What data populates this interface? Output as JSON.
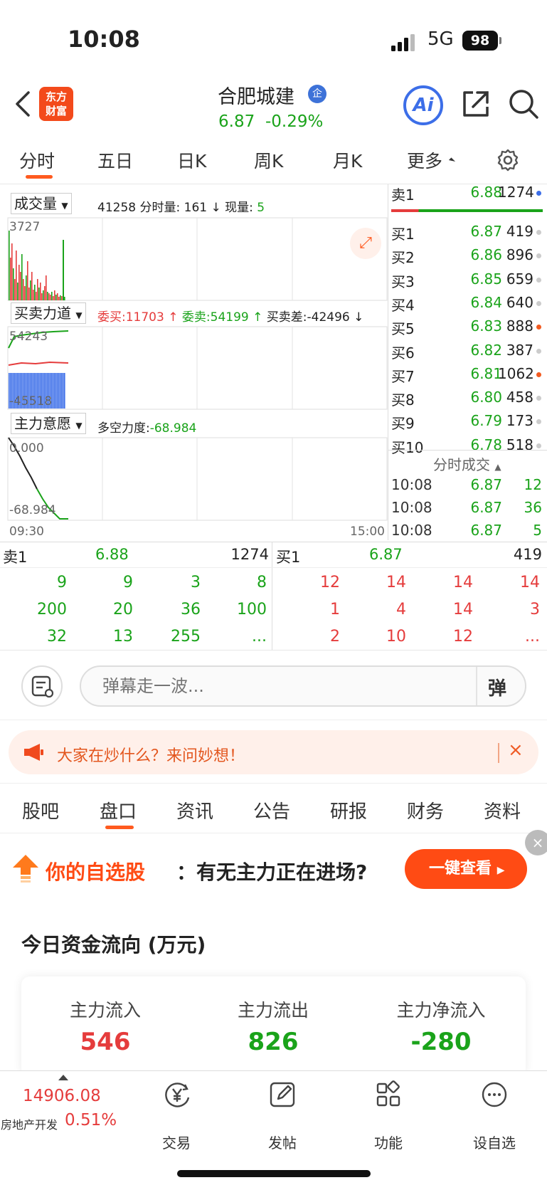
{
  "status": {
    "time": "10:08",
    "network": "5G",
    "battery": "98"
  },
  "header": {
    "logo_top": "东方",
    "logo_bottom": "财富",
    "stock_name": "合肥城建",
    "badge": "企",
    "price": "6.87",
    "change": "-0.29%",
    "ai_label": "Ai",
    "price_color": "#1aa31a"
  },
  "chart_tabs": [
    "分时",
    "五日",
    "日K",
    "周K",
    "月K",
    "更多"
  ],
  "chart": {
    "volume_panel": {
      "label": "成交量",
      "total": "41258",
      "minute_label": "分时量:",
      "minute_value": "161",
      "current_label": "现量:",
      "current_value": "5",
      "max_label": "3727"
    },
    "force_panel": {
      "label": "买卖力道",
      "buy_label": "委买:",
      "buy_value": "11703",
      "sell_label": "委卖:",
      "sell_value": "54199",
      "diff_label": "买卖差:",
      "diff_value": "-42496",
      "top_label": "54243",
      "bottom_label": "-45518"
    },
    "intent_panel": {
      "label": "主力意愿",
      "force_label": "多空力度:",
      "force_value": "-68.984",
      "top_label": "0.000",
      "bottom_label": "-68.984"
    },
    "time_start": "09:30",
    "time_end": "15:00"
  },
  "order_book": {
    "sell": [
      {
        "label": "卖1",
        "price": "6.88",
        "volume": "1274",
        "dot": "#3c6ee8"
      }
    ],
    "buy": [
      {
        "label": "买1",
        "price": "6.87",
        "volume": "419",
        "dot": "#cccccc"
      },
      {
        "label": "买2",
        "price": "6.86",
        "volume": "896",
        "dot": "#cccccc"
      },
      {
        "label": "买3",
        "price": "6.85",
        "volume": "659",
        "dot": "#cccccc"
      },
      {
        "label": "买4",
        "price": "6.84",
        "volume": "640",
        "dot": "#cccccc"
      },
      {
        "label": "买5",
        "price": "6.83",
        "volume": "888",
        "dot": "#f25a1f"
      },
      {
        "label": "买6",
        "price": "6.82",
        "volume": "387",
        "dot": "#cccccc"
      },
      {
        "label": "买7",
        "price": "6.81",
        "volume": "1062",
        "dot": "#f25a1f"
      },
      {
        "label": "买8",
        "price": "6.80",
        "volume": "458",
        "dot": "#cccccc"
      },
      {
        "label": "买9",
        "price": "6.79",
        "volume": "173",
        "dot": "#cccccc"
      },
      {
        "label": "买10",
        "price": "6.78",
        "volume": "518",
        "dot": "#cccccc"
      }
    ],
    "trades_title": "分时成交",
    "trades": [
      {
        "time": "10:08",
        "price": "6.87",
        "volume": "12"
      },
      {
        "time": "10:08",
        "price": "6.87",
        "volume": "36"
      },
      {
        "time": "10:08",
        "price": "6.87",
        "volume": "5"
      }
    ]
  },
  "queue": {
    "sell": {
      "label": "卖1",
      "price": "6.88",
      "volume": "1274",
      "rows": [
        [
          "9",
          "9",
          "3",
          "8"
        ],
        [
          "200",
          "20",
          "36",
          "100"
        ],
        [
          "32",
          "13",
          "255",
          "..."
        ]
      ]
    },
    "buy": {
      "label": "买1",
      "price": "6.87",
      "volume": "419",
      "rows": [
        [
          "12",
          "14",
          "14",
          "14"
        ],
        [
          "1",
          "4",
          "14",
          "3"
        ],
        [
          "2",
          "10",
          "12",
          "..."
        ]
      ]
    }
  },
  "comment": {
    "placeholder": "弹幕走一波...",
    "button": "弹"
  },
  "promo": {
    "text": "大家在炒什么？来问妙想！"
  },
  "section_tabs": [
    "股吧",
    "盘口",
    "资讯",
    "公告",
    "研报",
    "财务",
    "资料"
  ],
  "ad": {
    "highlight": "你的自选股",
    "text": "：有无主力正在进场?",
    "button": "一键查看"
  },
  "fund_flow": {
    "title": "今日资金流向 (万元)",
    "items": [
      {
        "label": "主力流入",
        "value": "546",
        "color": "#e53c3c"
      },
      {
        "label": "主力流出",
        "value": "826",
        "color": "#1aa31a"
      },
      {
        "label": "主力净流入",
        "value": "-280",
        "color": "#1aa31a"
      }
    ]
  },
  "bottom_nav": {
    "index_value": "14906.08",
    "index_name": "房地产开发",
    "index_change": "0.51%",
    "items": [
      "交易",
      "发帖",
      "功能",
      "设自选"
    ]
  }
}
